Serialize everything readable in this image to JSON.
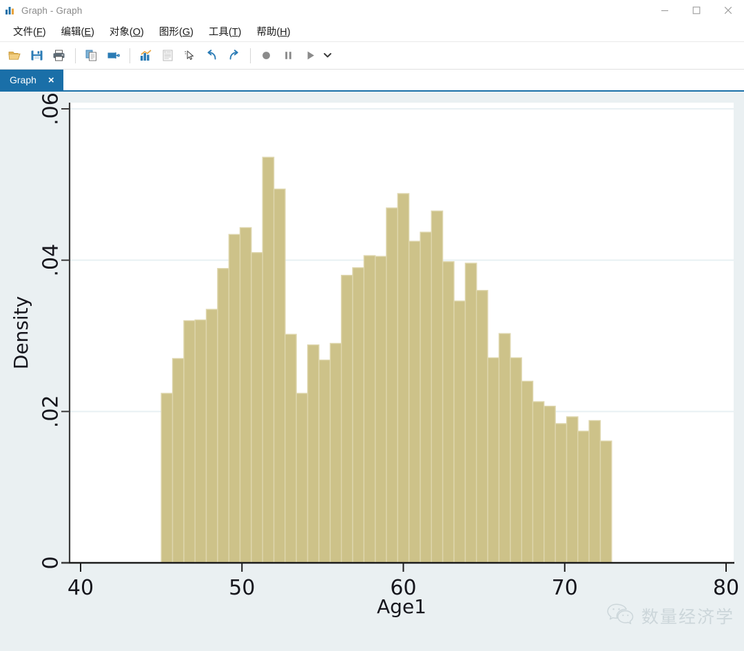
{
  "window": {
    "title": "Graph - Graph",
    "app_icon": "bar-chart-icon",
    "controls": {
      "minimize": "minimize-icon",
      "maximize": "maximize-icon",
      "close": "close-icon"
    }
  },
  "menubar": {
    "items": [
      {
        "label": "文件(F)",
        "name": "menu-file",
        "main": "文件(",
        "accel": "F",
        "tail": ")"
      },
      {
        "label": "编辑(E)",
        "name": "menu-edit",
        "main": "编辑(",
        "accel": "E",
        "tail": ")"
      },
      {
        "label": "对象(O)",
        "name": "menu-object",
        "main": "对象(",
        "accel": "O",
        "tail": ")"
      },
      {
        "label": "图形(G)",
        "name": "menu-graphics",
        "main": "图形(",
        "accel": "G",
        "tail": ")"
      },
      {
        "label": "工具(T)",
        "name": "menu-tools",
        "main": "工具(",
        "accel": "T",
        "tail": ")"
      },
      {
        "label": "帮助(H)",
        "name": "menu-help",
        "main": "帮助(",
        "accel": "H",
        "tail": ")"
      }
    ]
  },
  "toolbar": {
    "buttons": [
      {
        "icon": "open-folder-icon",
        "name": "open-button"
      },
      {
        "icon": "save-floppy-icon",
        "name": "save-button"
      },
      {
        "icon": "print-icon",
        "name": "print-button"
      },
      {
        "icon": "copy-icon",
        "name": "copy-button"
      },
      {
        "icon": "paste-icon",
        "name": "paste-button"
      },
      {
        "icon": "new-graph-icon",
        "name": "new-graph-button"
      },
      {
        "icon": "log-viewer-icon",
        "name": "log-viewer-button"
      },
      {
        "icon": "pointer-icon",
        "name": "select-tool-button"
      },
      {
        "icon": "undo-icon",
        "name": "undo-button"
      },
      {
        "icon": "redo-icon",
        "name": "redo-button"
      },
      {
        "icon": "record-icon",
        "name": "record-button"
      },
      {
        "icon": "pause-icon",
        "name": "pause-button"
      },
      {
        "icon": "play-icon",
        "name": "play-button"
      },
      {
        "icon": "chevron-down-icon",
        "name": "toolbar-overflow-button"
      }
    ]
  },
  "tabs": [
    {
      "label": "Graph",
      "close": "×",
      "active": true
    }
  ],
  "watermark": {
    "icon": "wechat-icon",
    "text": "数量经济学"
  },
  "chart_data": {
    "type": "bar",
    "title": "",
    "xlabel": "Age1",
    "ylabel": "Density",
    "xlim": [
      40,
      80
    ],
    "ylim": [
      0,
      0.06
    ],
    "xticks": [
      "40",
      "50",
      "60",
      "70",
      "80"
    ],
    "xtick_values": [
      40,
      50,
      60,
      70,
      80
    ],
    "yticks": [
      "0",
      ".02",
      ".04",
      ".06"
    ],
    "ytick_values": [
      0,
      0.02,
      0.04,
      0.06
    ],
    "grid": "horizontal",
    "bar_color": "#cdc289",
    "bar_edge_color": "#ded6ad",
    "plot_bg": "#ffffff",
    "graph_bg": "#eaf0f2",
    "bin_width": 0.697,
    "bin_start": 45.0,
    "bin_end": 75.0,
    "bin_left_edges": [
      45.0,
      45.7,
      46.4,
      47.09,
      47.79,
      48.49,
      49.19,
      49.88,
      50.58,
      51.28,
      51.98,
      52.67,
      53.37,
      54.07,
      54.77,
      55.47,
      56.16,
      56.86,
      57.56,
      58.26,
      58.95,
      59.65,
      60.35,
      61.05,
      61.74,
      62.44,
      63.14,
      63.84,
      64.53,
      65.23,
      65.93,
      66.63,
      67.33,
      68.02,
      68.72,
      69.42,
      70.12,
      70.81,
      71.51,
      72.21,
      72.91,
      73.6,
      74.3
    ],
    "values": [
      0.0224,
      0.027,
      0.032,
      0.0321,
      0.0335,
      0.0389,
      0.0434,
      0.0443,
      0.041,
      0.0536,
      0.0494,
      0.0302,
      0.0224,
      0.0288,
      0.0268,
      0.029,
      0.038,
      0.039,
      0.0406,
      0.0405,
      0.0469,
      0.0488,
      0.0425,
      0.0437,
      0.0465,
      0.0398,
      0.0346,
      0.0396,
      0.036,
      0.0271,
      0.0303,
      0.0271,
      0.024,
      0.0213,
      0.0207,
      0.0184,
      0.0193,
      0.0174,
      0.0188,
      0.0161
    ]
  }
}
